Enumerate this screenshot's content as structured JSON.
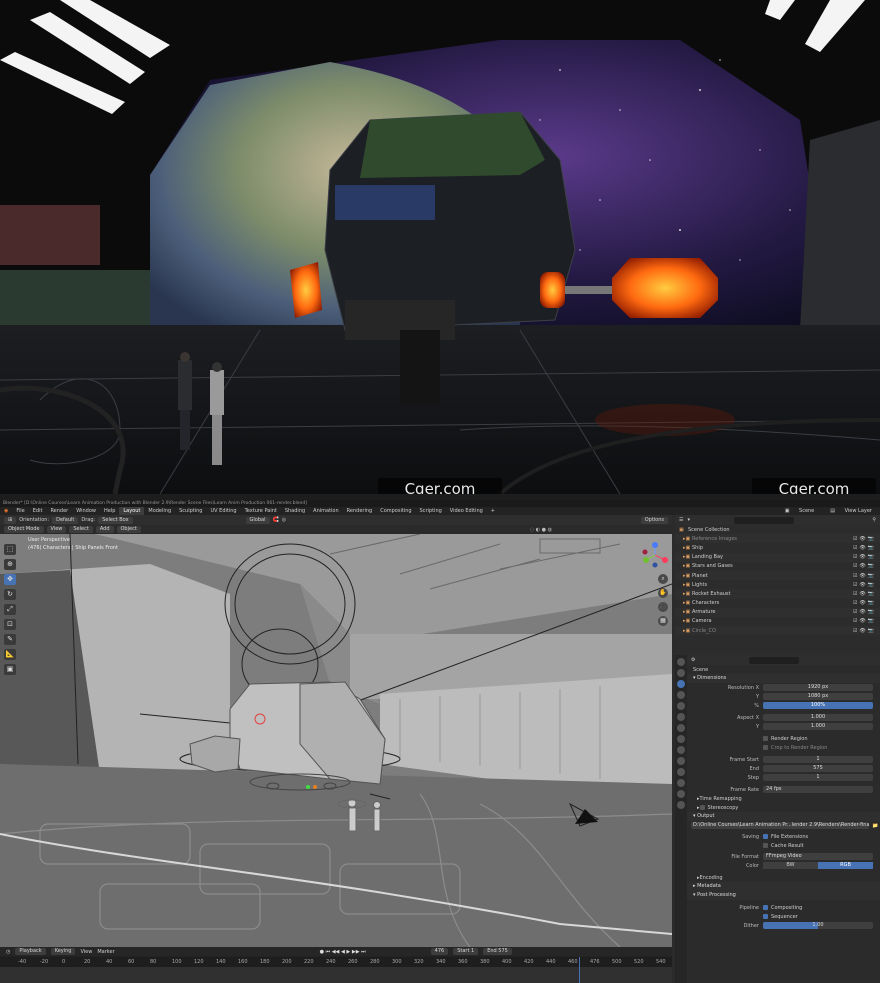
{
  "watermark": "Cger.com",
  "title": "Blender* [D:\\Online Courses\\Learn Animation Production with Blender 2.9\\Render Scene Files\\Learn Anim Production 061-render.blend]",
  "menu": [
    "File",
    "Edit",
    "Render",
    "Window",
    "Help"
  ],
  "workspaces": [
    "Layout",
    "Modeling",
    "Sculpting",
    "UV Editing",
    "Texture Paint",
    "Shading",
    "Animation",
    "Rendering",
    "Compositing",
    "Scripting",
    "Video Editing"
  ],
  "active_workspace": "Layout",
  "top_right": {
    "scene_label": "Scene",
    "view_layer_label": "View Layer"
  },
  "viewport_header": {
    "orientation_label": "Orientation:",
    "orientation_value": "Default",
    "drag_label": "Drag:",
    "drag_value": "Select Box",
    "transform": "Global",
    "options": "Options"
  },
  "viewport_header2": {
    "mode": "Object Mode",
    "view": "View",
    "select": "Select",
    "add": "Add",
    "object": "Object"
  },
  "viewport_info": {
    "perspective": "User Perspective",
    "collection": "(476) Characters | Ship Panels Front"
  },
  "timeline": {
    "playback": "Playback",
    "keying": "Keying",
    "view": "View",
    "marker": "Marker",
    "current_frame": "476",
    "start_label": "Start",
    "start": "1",
    "end_label": "End",
    "end": "575",
    "ruler": [
      "-40",
      "-20",
      "0",
      "20",
      "40",
      "60",
      "80",
      "100",
      "120",
      "140",
      "160",
      "180",
      "200",
      "220",
      "240",
      "260",
      "280",
      "300",
      "320",
      "340",
      "360",
      "380",
      "400",
      "420",
      "440",
      "460",
      "476",
      "500",
      "520",
      "540"
    ]
  },
  "outliner": {
    "header": "Scene Collection",
    "items": [
      {
        "name": "Reference Images",
        "dim": true
      },
      {
        "name": "Ship"
      },
      {
        "name": "Landing Bay"
      },
      {
        "name": "Stars and Gases"
      },
      {
        "name": "Planet"
      },
      {
        "name": "Lights"
      },
      {
        "name": "Rocket Exhaust"
      },
      {
        "name": "Characters"
      },
      {
        "name": "Armature"
      },
      {
        "name": "Camera"
      },
      {
        "name": "Circle_CO",
        "dim": true
      }
    ]
  },
  "properties": {
    "scene": "Scene",
    "dimensions": "Dimensions",
    "resolution_x_label": "Resolution X",
    "resolution_x": "1920 px",
    "y_label": "Y",
    "resolution_y": "1080 px",
    "pct_label": "%",
    "resolution_pct": "100%",
    "aspect_x_label": "Aspect X",
    "aspect_x": "1.000",
    "aspect_y": "1.000",
    "render_region": "Render Region",
    "crop": "Crop to Render Region",
    "frame_start_label": "Frame Start",
    "frame_start": "1",
    "end_label": "End",
    "frame_end": "575",
    "step_label": "Step",
    "frame_step": "1",
    "frame_rate_label": "Frame Rate",
    "frame_rate": "24 fps",
    "time_remapping": "Time Remapping",
    "stereoscopy": "Stereoscopy",
    "output": "Output",
    "output_path": "D:\\Online Courses\\Learn Animation Pr...lender 2.9\\Renders\\Render-final2.mp4",
    "saving_label": "Saving",
    "file_extensions": "File Extensions",
    "cache_result": "Cache Result",
    "file_format_label": "File Format",
    "file_format": "FFmpeg Video",
    "color_label": "Color",
    "bw": "BW",
    "rgb": "RGB",
    "encoding": "Encoding",
    "metadata": "Metadata",
    "post_processing": "Post Processing",
    "pipeline_label": "Pipeline",
    "compositing": "Compositing",
    "sequencer": "Sequencer",
    "dither_label": "Dither",
    "dither": "1.00"
  },
  "colors": {
    "accent": "#4772b3",
    "lava": "#ff5a1a",
    "ui_bg": "#2b2b2b"
  }
}
